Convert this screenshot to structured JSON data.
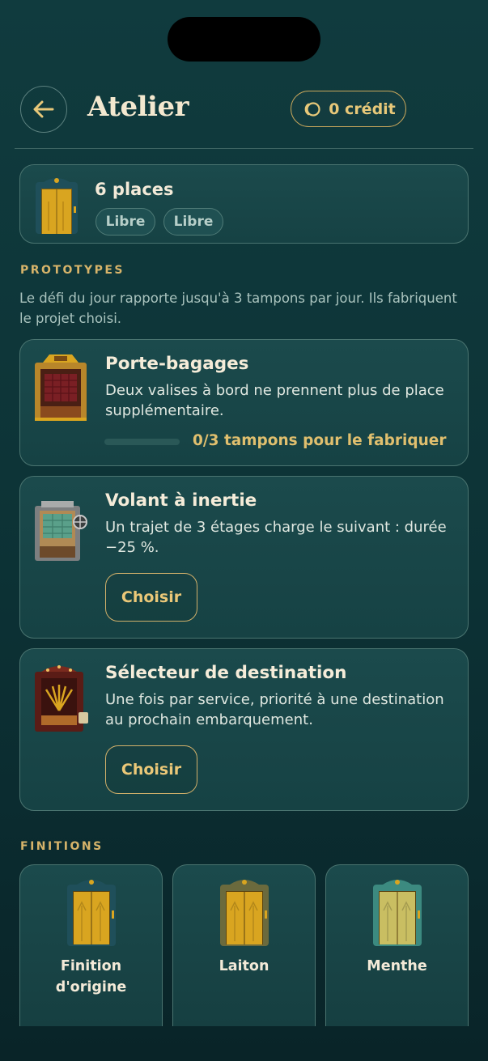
{
  "header": {
    "title": "Atelier",
    "credit_label": "0 crédit"
  },
  "capacity": {
    "title": "6 places",
    "slots": [
      "Libre",
      "Libre"
    ]
  },
  "prototypes": {
    "section_label": "PROTOTYPES",
    "description": "Le défi du jour rapporte jusqu'à 3 tampons par jour. Ils fabriquent le projet choisi.",
    "items": [
      {
        "title": "Porte-bagages",
        "description": "Deux valises à bord ne prennent plus de place supplémentaire.",
        "progress_label": "0/3 tampons pour le fabriquer",
        "progress": 0
      },
      {
        "title": "Volant à inertie",
        "description": "Un trajet de 3 étages charge le suivant : durée −25 %.",
        "button_label": "Choisir"
      },
      {
        "title": "Sélecteur de destination",
        "description": "Une fois par service, priorité à une destination au prochain embarquement.",
        "button_label": "Choisir"
      }
    ]
  },
  "finishes": {
    "section_label": "FINITIONS",
    "items": [
      {
        "label": "Finition d'origine",
        "frame_color": "#1f4f5a",
        "door_color": "#d9a520"
      },
      {
        "label": "Laiton",
        "frame_color": "#6b6a3d",
        "door_color": "#d9a520"
      },
      {
        "label": "Menthe",
        "frame_color": "#3c8a80",
        "door_color": "#c9be62"
      }
    ]
  },
  "colors": {
    "accent_gold": "#e0bf6e",
    "background": "#0f393c",
    "card_border": "#4a7470"
  }
}
